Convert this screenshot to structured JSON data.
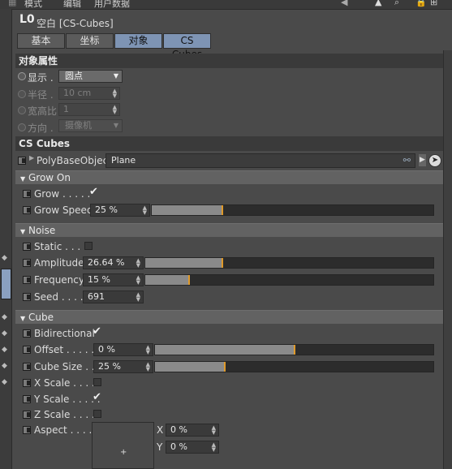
{
  "menubar": {
    "items": [
      "模式",
      "编辑",
      "用户数据"
    ]
  },
  "title": {
    "icon_glyph": "L0",
    "text": "空白 [CS-Cubes]"
  },
  "tabs": [
    {
      "label": "基本",
      "active": false
    },
    {
      "label": "坐标",
      "active": false
    },
    {
      "label": "对象",
      "active": true
    },
    {
      "label": "CS Cubes",
      "active": true
    }
  ],
  "object_properties": {
    "header": "对象属性",
    "display": {
      "label": "显示 .",
      "value": "圆点"
    },
    "radius": {
      "label": "半径 .",
      "value": "10 cm"
    },
    "aspect_ratio": {
      "label": "宽高比",
      "value": "1"
    },
    "orientation": {
      "label": "方向 .",
      "value": "摄像机"
    }
  },
  "cs_cubes": {
    "header": "CS Cubes",
    "poly_base_object": {
      "label": "PolyBaseObject",
      "value": "Plane"
    },
    "grow_on": {
      "header": "Grow On",
      "grow": {
        "label": "Grow . . . . .",
        "checked": true
      },
      "grow_speed": {
        "label": "Grow Speed",
        "value": "25 %",
        "fill": 0.25
      }
    },
    "noise": {
      "header": "Noise",
      "static": {
        "label": "Static . . . .",
        "checked": false
      },
      "amplitude": {
        "label": "Amplitude",
        "value": "26.64 %",
        "fill": 0.27
      },
      "frequency": {
        "label": "Frequency",
        "value": "15 %",
        "fill": 0.15
      },
      "seed": {
        "label": "Seed . . . . .",
        "value": "691"
      }
    },
    "cube": {
      "header": "Cube",
      "bidirectional": {
        "label": "Bidirectional",
        "checked": true
      },
      "offset": {
        "label": "Offset . . . . .",
        "value": "0 %",
        "fill": 0.5
      },
      "cube_size": {
        "label": "Cube Size . .",
        "value": "25 %",
        "fill": 0.25
      },
      "x_scale": {
        "label": "X Scale . . . . .",
        "checked": false
      },
      "y_scale": {
        "label": "Y Scale . . . . .",
        "checked": true
      },
      "z_scale": {
        "label": "Z Scale . . . . .",
        "checked": false
      },
      "aspect": {
        "label": "Aspect . . . . . .",
        "x_label": "X",
        "x_value": "0 %",
        "y_label": "Y",
        "y_value": "0 %"
      }
    }
  },
  "colors": {
    "accent": "#7e94b4",
    "slider_marker": "#e09a2a",
    "background": "#4a4a4a"
  }
}
